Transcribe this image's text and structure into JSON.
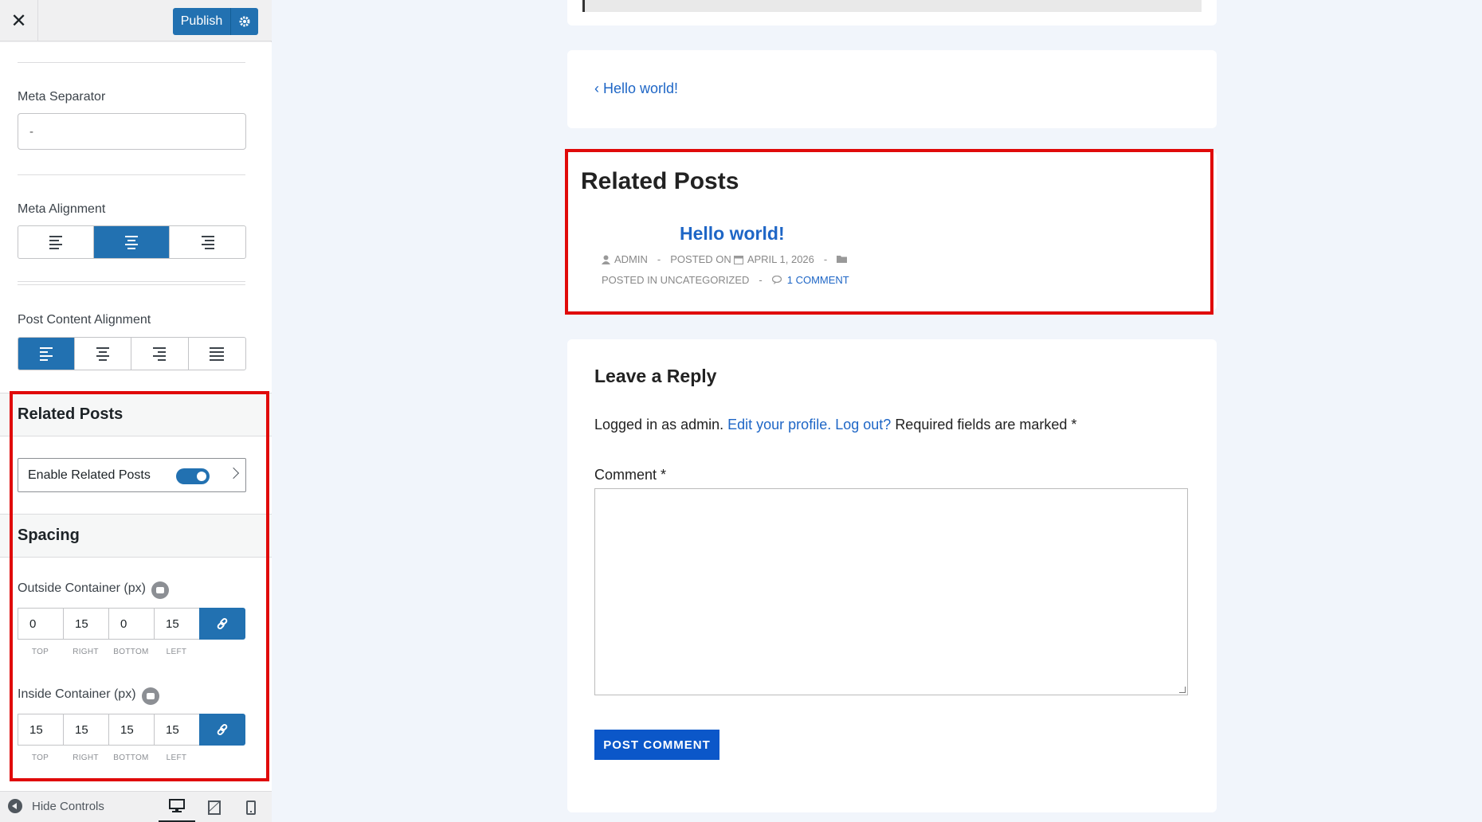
{
  "topbar": {
    "close_glyph": "✕",
    "publish_label": "Publish",
    "gear_icon": "gear-icon"
  },
  "meta_separator": {
    "label": "Meta Separator",
    "value": "-"
  },
  "meta_alignment": {
    "label": "Meta Alignment",
    "active": "center"
  },
  "post_content_alignment": {
    "label": "Post Content Alignment",
    "active": "left"
  },
  "related_posts_section": {
    "title": "Related Posts",
    "enable_label": "Enable Related Posts",
    "enabled": true
  },
  "spacing_section": {
    "title": "Spacing",
    "outside": {
      "label": "Outside Container (px)",
      "top": "0",
      "right": "15",
      "bottom": "0",
      "left": "15"
    },
    "inside": {
      "label": "Inside Container (px)",
      "top": "15",
      "right": "15",
      "bottom": "15",
      "left": "15"
    },
    "dim_labels": {
      "top": "TOP",
      "right": "RIGHT",
      "bottom": "BOTTOM",
      "left": "LEFT"
    }
  },
  "footer": {
    "hide_controls": "Hide Controls",
    "devices": [
      "desktop-icon",
      "tablet-icon",
      "mobile-icon"
    ]
  },
  "preview": {
    "prev_post_link": "‹ Hello world!",
    "related": {
      "heading": "Related Posts",
      "post_title": "Hello world!",
      "author": "ADMIN",
      "sep": "-",
      "posted_on": "POSTED ON",
      "date": "APRIL 1, 2026",
      "posted_in": "POSTED IN UNCATEGORIZED",
      "comments": "1 COMMENT"
    },
    "reply": {
      "heading": "Leave a Reply",
      "logged_prefix": "Logged in as admin.",
      "edit_profile": "Edit your profile.",
      "log_out": "Log out?",
      "required": "Required fields are marked *",
      "comment_label": "Comment *",
      "submit": "POST COMMENT"
    }
  },
  "colors": {
    "accent": "#2271b1",
    "highlight": "#e00a0a",
    "link": "#1e66c6"
  }
}
